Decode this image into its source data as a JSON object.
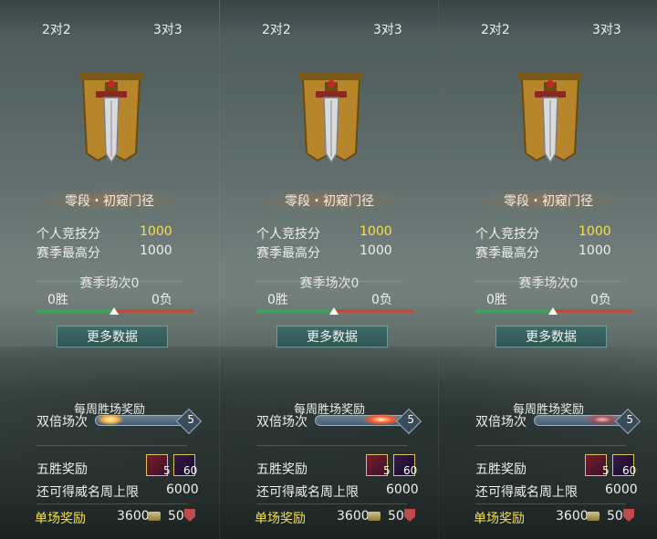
{
  "panels": [
    {
      "tabs": [
        "2对2",
        "3对3"
      ],
      "rank_name": "零段・初窥门径",
      "personal_score_label": "个人竞技分",
      "personal_score": "1000",
      "season_high_label": "赛季最高分",
      "season_high": "1000",
      "season_matches_label": "赛季场次0",
      "wins": "0胜",
      "losses": "0负",
      "more_data_label": "更多数据",
      "weekly_reward_label": "每周胜场奖励",
      "double_label": "双倍场次",
      "double_count": "5",
      "five_win_label": "五胜奖励",
      "five_win_item1_count": "5",
      "five_win_item2_count": "60",
      "prestige_label": "还可得威名周上限",
      "prestige_value": "6000",
      "single_reward_label": "单场奖励",
      "single_reward_coin": "3600",
      "single_reward_honor": "50"
    },
    {
      "tabs": [
        "2对2",
        "3对3"
      ],
      "rank_name": "零段・初窥门径",
      "personal_score_label": "个人竞技分",
      "personal_score": "1000",
      "season_high_label": "赛季最高分",
      "season_high": "1000",
      "season_matches_label": "赛季场次0",
      "wins": "0胜",
      "losses": "0负",
      "more_data_label": "更多数据",
      "weekly_reward_label": "每周胜场奖励",
      "double_label": "双倍场次",
      "double_count": "5",
      "five_win_label": "五胜奖励",
      "five_win_item1_count": "5",
      "five_win_item2_count": "60",
      "prestige_label": "还可得威名周上限",
      "prestige_value": "6000",
      "single_reward_label": "单场奖励",
      "single_reward_coin": "3600",
      "single_reward_honor": "50"
    },
    {
      "tabs": [
        "2对2",
        "3对3"
      ],
      "rank_name": "零段・初窥门径",
      "personal_score_label": "个人竞技分",
      "personal_score": "1000",
      "season_high_label": "赛季最高分",
      "season_high": "1000",
      "season_matches_label": "赛季场次0",
      "wins": "0胜",
      "losses": "0负",
      "more_data_label": "更多数据",
      "weekly_reward_label": "每周胜场奖励",
      "double_label": "双倍场次",
      "double_count": "5",
      "five_win_label": "五胜奖励",
      "five_win_item1_count": "5",
      "five_win_item2_count": "60",
      "prestige_label": "还可得威名周上限",
      "prestige_value": "6000",
      "single_reward_label": "单场奖励",
      "single_reward_coin": "3600",
      "single_reward_honor": "50"
    }
  ],
  "colors": {
    "highlight_yellow": "#f5e04a",
    "win_green": "#3ea15c",
    "loss_red": "#b5503a",
    "button_teal": "#3f6b69"
  }
}
